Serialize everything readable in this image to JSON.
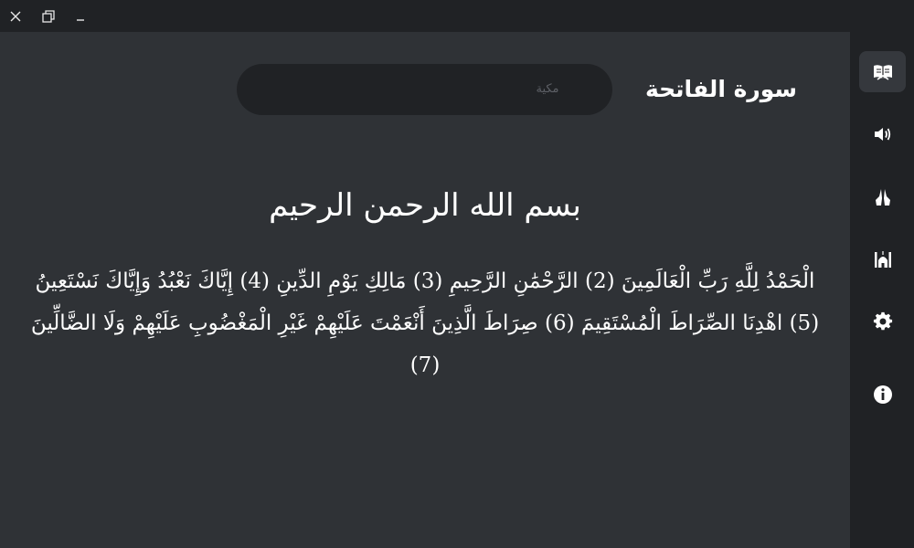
{
  "window": {
    "close_icon": "close-icon",
    "restore_icon": "restore-icon",
    "minimize_icon": "minimize-icon"
  },
  "header": {
    "surah_name": "سورة الفاتحة",
    "revelation_type": "مكية"
  },
  "basmala": "بسم الله الرحمن الرحيم",
  "verses": [
    {
      "text": "الْحَمْدُ لِلَّهِ رَبِّ الْعَالَمِينَ (2)"
    },
    {
      "text": "الرَّحْمَٰنِ الرَّحِيمِ (3)"
    },
    {
      "text": "مَالِكِ يَوْمِ الدِّينِ (4)"
    },
    {
      "text": "إِيَّاكَ نَعْبُدُ وَإِيَّاكَ نَسْتَعِينُ (5)"
    },
    {
      "text": "اهْدِنَا الصِّرَاطَ الْمُسْتَقِيمَ (6)"
    },
    {
      "text": "صِرَاطَ الَّذِينَ أَنْعَمْتَ عَلَيْهِمْ غَيْرِ الْمَغْضُوبِ عَلَيْهِمْ وَلَا الضَّالِّينَ (7)"
    }
  ],
  "sidebar": {
    "items": [
      {
        "icon": "quran-book-icon",
        "active": true
      },
      {
        "icon": "speaker-icon",
        "active": false
      },
      {
        "icon": "praying-hands-icon",
        "active": false
      },
      {
        "icon": "mosque-icon",
        "active": false
      },
      {
        "icon": "gear-icon",
        "active": false
      },
      {
        "icon": "info-icon",
        "active": false
      }
    ]
  },
  "colors": {
    "background": "#2f3236",
    "panel": "#202225",
    "active_item": "#35383d",
    "text": "#ffffff",
    "muted_text": "#5d6066"
  }
}
